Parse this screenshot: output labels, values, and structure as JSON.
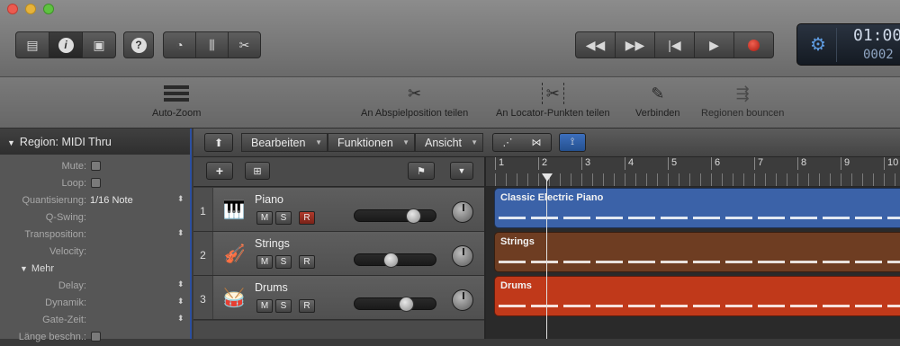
{
  "inspector": {
    "header": "Region: MIDI Thru",
    "rows": [
      {
        "label": "Mute:",
        "value": ""
      },
      {
        "label": "Loop:",
        "value": ""
      },
      {
        "label": "Quantisierung:",
        "value": "1/16 Note"
      },
      {
        "label": "Q-Swing:",
        "value": ""
      },
      {
        "label": "Transposition:",
        "value": ""
      },
      {
        "label": "Velocity:",
        "value": ""
      },
      {
        "label": "Mehr",
        "value": ""
      },
      {
        "label": "Delay:",
        "value": ""
      },
      {
        "label": "Dynamik:",
        "value": ""
      },
      {
        "label": "Gate-Zeit:",
        "value": ""
      },
      {
        "label": "Länge beschn.:",
        "value": ""
      }
    ]
  },
  "toolbar2": {
    "auto_zoom": "Auto-Zoom",
    "split_playhead": "An Abspielposition teilen",
    "split_locators": "An Locator-Punkten teilen",
    "join": "Verbinden",
    "bounce": "Regionen bouncen"
  },
  "lcd": {
    "time": "01:00",
    "bar": "0002"
  },
  "menus": {
    "edit": "Bearbeiten",
    "functions": "Funktionen",
    "view": "Ansicht"
  },
  "ruler": [
    "1",
    "2",
    "3",
    "4",
    "5",
    "6",
    "7",
    "8",
    "9",
    "10"
  ],
  "tracks": [
    {
      "num": "1",
      "name": "Piano",
      "m": "M",
      "s": "S",
      "r": "R",
      "region": "Classic Electric Piano",
      "color": "#3b62a8",
      "volume": 0.72
    },
    {
      "num": "2",
      "name": "Strings",
      "m": "M",
      "s": "S",
      "r": "R",
      "region": "Strings",
      "color": "#6e3d22",
      "volume": 0.45
    },
    {
      "num": "3",
      "name": "Drums",
      "m": "M",
      "s": "S",
      "r": "R",
      "region": "Drums",
      "color": "#c0391a",
      "volume": 0.63
    }
  ]
}
